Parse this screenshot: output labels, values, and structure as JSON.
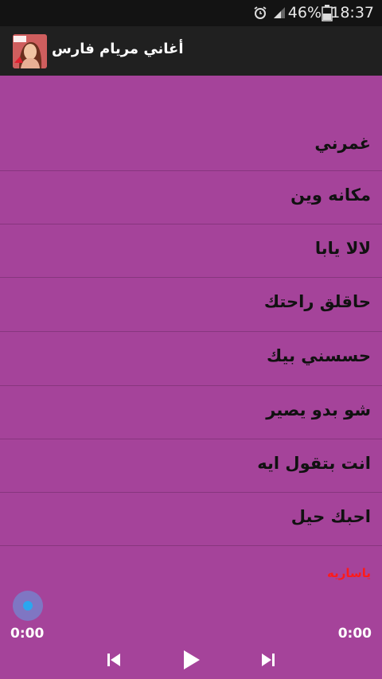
{
  "status_bar": {
    "time": "18:37",
    "battery": "46%"
  },
  "app": {
    "title": "أغاني مريام فارس"
  },
  "songs": [
    {
      "label": "غمرني"
    },
    {
      "label": "مكانه وين"
    },
    {
      "label": "لالا يابا"
    },
    {
      "label": "حاقلق راحتك"
    },
    {
      "label": "حسسني بيك"
    },
    {
      "label": "شو بدو يصير"
    },
    {
      "label": "انت بتقول ايه"
    },
    {
      "label": "احبك حيل"
    }
  ],
  "player": {
    "now_playing": "ياساريه",
    "elapsed": "0:00",
    "duration": "0:00",
    "progress": 0
  },
  "colors": {
    "background": "#a5439a",
    "statusbar": "#131313",
    "appbar": "#202020",
    "now_playing": "#ff1a1a",
    "seek_knob": "#2aa7ef"
  }
}
